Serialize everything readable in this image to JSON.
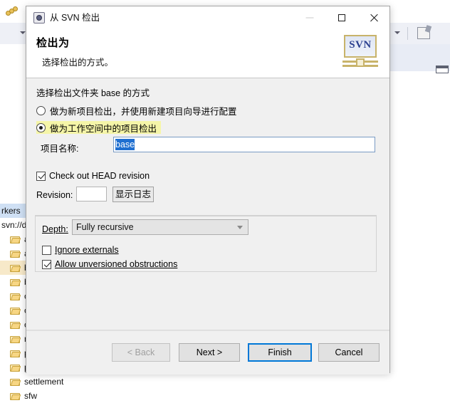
{
  "ide": {
    "toolbar": {
      "wrench_icon": "wrench-icon",
      "dropdown_icon": "chevron-down-icon",
      "new_file_icon": "new-file-icon"
    },
    "tree": {
      "header_label": "rkers",
      "root_label": "svn://d",
      "items": [
        {
          "label": "asse",
          "selected": false
        },
        {
          "label": "asse",
          "selected": false
        },
        {
          "label": "base",
          "selected": true
        },
        {
          "label": "blas",
          "selected": false
        },
        {
          "label": "cms",
          "selected": false
        },
        {
          "label": "cont",
          "selected": false
        },
        {
          "label": "cont",
          "selected": false
        },
        {
          "label": "mall",
          "selected": false
        },
        {
          "label": "psm",
          "selected": false
        },
        {
          "label": "psmaccustom",
          "selected": false
        },
        {
          "label": "settlement",
          "selected": false
        },
        {
          "label": "sfw",
          "selected": false
        }
      ]
    }
  },
  "dialog": {
    "titlebar": {
      "icon": "svn-app-icon",
      "title": "从 SVN 检出",
      "minimize_label": "minimize-icon",
      "maximize_label": "maximize-icon",
      "close_label": "close-icon"
    },
    "header": {
      "heading": "检出为",
      "subheading": "选择检出的方式。",
      "logo_text": "SVN"
    },
    "body": {
      "section_label": "选择检出文件夹 base 的方式",
      "radios": [
        {
          "label": "做为新项目检出，并使用新建项目向导进行配置",
          "checked": false,
          "highlighted": false
        },
        {
          "label": "做为工作空间中的项目检出",
          "checked": true,
          "highlighted": true
        }
      ],
      "project_name_label": "项目名称:",
      "project_name_value": "base",
      "head_revision_checkbox": {
        "label": "Check out HEAD revision",
        "checked": true
      },
      "revision_label": "Revision:",
      "revision_value": "",
      "show_log_button": "显示日志",
      "depth_label": "Depth:",
      "depth_value": "Fully recursive",
      "depth_dropdown_icon": "chevron-down-icon",
      "ignore_externals_checkbox": {
        "label": "Ignore externals",
        "checked": false
      },
      "allow_unversioned_checkbox": {
        "label": "Allow unversioned obstructions",
        "checked": true
      }
    },
    "footer": {
      "back_label": "< Back",
      "next_label": "Next >",
      "finish_label": "Finish",
      "cancel_label": "Cancel"
    }
  },
  "colors": {
    "accent_blue": "#0078d7",
    "selection_blue": "#1f6fd0",
    "highlight_yellow": "#f5f5a8",
    "tree_selected": "#f7e9c9",
    "dialog_bg": "#f0f0f0"
  }
}
